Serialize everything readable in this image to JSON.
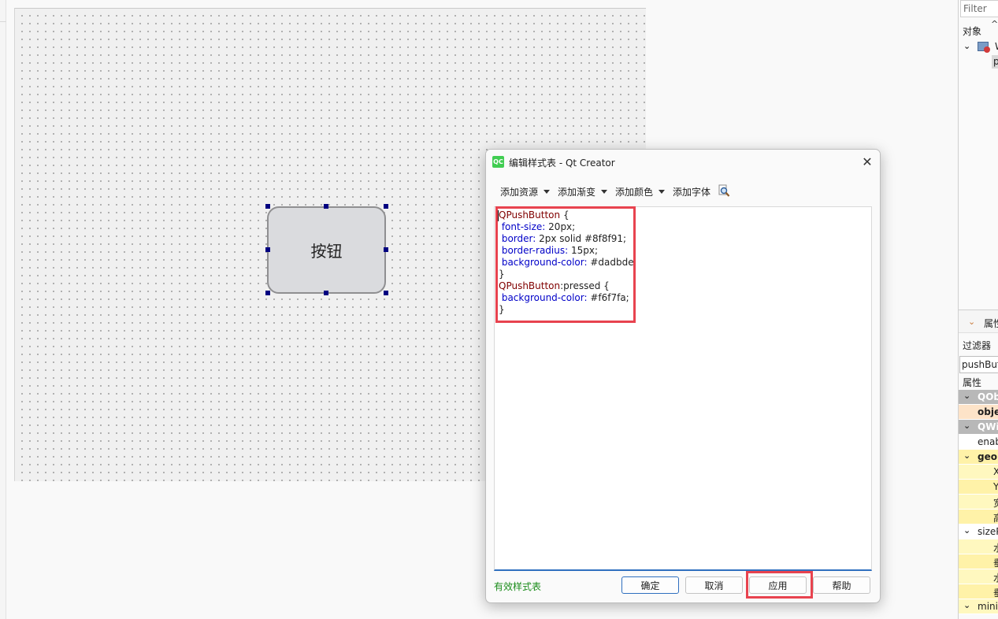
{
  "dialog": {
    "logo_text": "QC",
    "title": "编辑样式表 - Qt Creator",
    "close_glyph": "✕",
    "toolbar": {
      "add_resource": "添加资源",
      "add_gradient": "添加渐变",
      "add_color": "添加颜色",
      "add_font": "添加字体"
    },
    "code": {
      "line1_sel": "QPushButton",
      "line1_rest": " {",
      "line2_prop": "font-size:",
      "line2_val": " 20px;",
      "line3_prop": "border:",
      "line3_val": " 2px solid #8f8f91;",
      "line4_prop": "border-radius:",
      "line4_val": " 15px;",
      "line5_prop": "background-color:",
      "line5_val": " #dadbde",
      "line6": "}",
      "line7_sel": "QPushButton",
      "line7_rest": ":pressed {",
      "line8_prop": "background-color:",
      "line8_val": " #f6f7fa;",
      "line9": "}"
    },
    "status": "有效样式表",
    "buttons": {
      "ok": "确定",
      "cancel": "取消",
      "apply": "应用",
      "help": "帮助"
    }
  },
  "canvas": {
    "button_label": "按钮"
  },
  "right_panel": {
    "filter_placeholder": "Filter",
    "object_header": "对象",
    "tree_item_1": "W",
    "tree_item_2": "p",
    "property_section": "属性",
    "filter_label": "过滤器",
    "filter_value": "pushButton",
    "property_header": "属性",
    "rows": [
      "QObj",
      "objectName",
      "QWid",
      "enabled",
      "geometry",
      "X",
      "Y",
      "宽",
      "高",
      "sizePolicy",
      "水",
      "垂",
      "水",
      "垂",
      "minimumSize"
    ]
  },
  "colors": {
    "highlight": "#e8434f",
    "selector": "#800000",
    "property": "#0000c8",
    "valid_status": "#1a8c1a"
  }
}
